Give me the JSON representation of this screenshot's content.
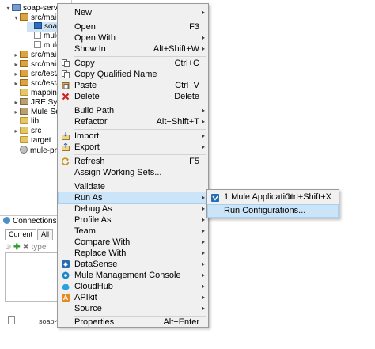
{
  "explorer": {
    "rows": [
      {
        "arrow": "▾",
        "label": "soap-service",
        "icon": "project-icon"
      },
      {
        "arrow": "▾",
        "label": "src/main",
        "icon": "folder-icon"
      },
      {
        "arrow": "",
        "label": "soap",
        "icon": "mule-icon"
      },
      {
        "arrow": "",
        "label": "mule",
        "icon": "file-icon"
      },
      {
        "arrow": "",
        "label": "mule",
        "icon": "file-icon"
      },
      {
        "arrow": "▸",
        "label": "src/main",
        "icon": "folder-icon"
      },
      {
        "arrow": "▸",
        "label": "src/main",
        "icon": "folder-icon"
      },
      {
        "arrow": "▸",
        "label": "src/test/",
        "icon": "folder-icon"
      },
      {
        "arrow": "▸",
        "label": "src/test/",
        "icon": "folder-icon"
      },
      {
        "arrow": "",
        "label": "mapping",
        "icon": "folder-icon"
      },
      {
        "arrow": "▸",
        "label": "JRE Syste",
        "icon": "library-icon"
      },
      {
        "arrow": "▸",
        "label": "Mule Ser",
        "icon": "library-icon"
      },
      {
        "arrow": "",
        "label": "lib",
        "icon": "folder-icon"
      },
      {
        "arrow": "▸",
        "label": "src",
        "icon": "folder-icon"
      },
      {
        "arrow": "",
        "label": "target",
        "icon": "folder-icon"
      },
      {
        "arrow": "",
        "label": "mule-pro",
        "icon": "gear-icon"
      }
    ]
  },
  "connections": {
    "title": "Connections Exp",
    "tabs": [
      "Current",
      "All"
    ],
    "filter_placeholder": "type",
    "status": "soap-v"
  },
  "menu": {
    "items": [
      {
        "label": "New",
        "accel": "",
        "submenu": true
      },
      {
        "label": "Open",
        "accel": "F3",
        "submenu": false
      },
      {
        "label": "Open With",
        "accel": "",
        "submenu": true
      },
      {
        "label": "Show In",
        "accel": "Alt+Shift+W",
        "submenu": true
      },
      {
        "label": "Copy",
        "accel": "Ctrl+C",
        "submenu": false
      },
      {
        "label": "Copy Qualified Name",
        "accel": "",
        "submenu": false
      },
      {
        "label": "Paste",
        "accel": "Ctrl+V",
        "submenu": false
      },
      {
        "label": "Delete",
        "accel": "Delete",
        "submenu": false
      },
      {
        "label": "Build Path",
        "accel": "",
        "submenu": true
      },
      {
        "label": "Refactor",
        "accel": "Alt+Shift+T",
        "submenu": true
      },
      {
        "label": "Import",
        "accel": "",
        "submenu": true
      },
      {
        "label": "Export",
        "accel": "",
        "submenu": true
      },
      {
        "label": "Refresh",
        "accel": "F5",
        "submenu": false
      },
      {
        "label": "Assign Working Sets...",
        "accel": "",
        "submenu": false
      },
      {
        "label": "Validate",
        "accel": "",
        "submenu": false
      },
      {
        "label": "Run As",
        "accel": "",
        "submenu": true
      },
      {
        "label": "Debug As",
        "accel": "",
        "submenu": true
      },
      {
        "label": "Profile As",
        "accel": "",
        "submenu": true
      },
      {
        "label": "Team",
        "accel": "",
        "submenu": true
      },
      {
        "label": "Compare With",
        "accel": "",
        "submenu": true
      },
      {
        "label": "Replace With",
        "accel": "",
        "submenu": true
      },
      {
        "label": "DataSense",
        "accel": "",
        "submenu": true
      },
      {
        "label": "Mule Management Console",
        "accel": "",
        "submenu": true
      },
      {
        "label": "CloudHub",
        "accel": "",
        "submenu": true
      },
      {
        "label": "APIkit",
        "accel": "",
        "submenu": true
      },
      {
        "label": "Source",
        "accel": "",
        "submenu": true
      },
      {
        "label": "Properties",
        "accel": "Alt+Enter",
        "submenu": false
      }
    ],
    "submenu_arrow": "▸"
  },
  "run_as_submenu": {
    "items": [
      {
        "label": "1 Mule Application",
        "accel": "Ctrl+Shift+X"
      },
      {
        "label": "Run Configurations...",
        "accel": ""
      }
    ]
  },
  "colors": {
    "highlight": "#cce4f7",
    "menu_bg": "#f0f0f0"
  }
}
